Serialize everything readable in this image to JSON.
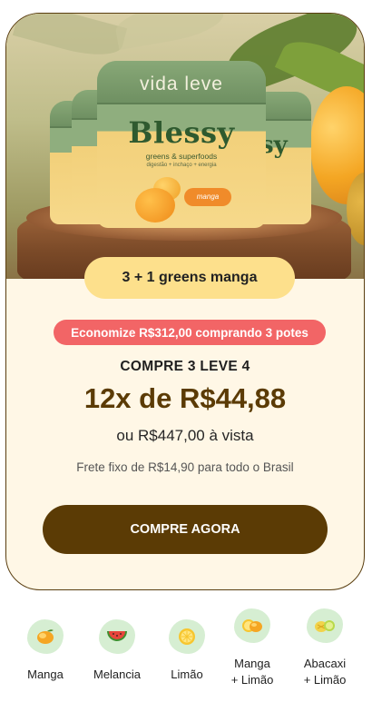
{
  "hero": {
    "jar_brand": "vida leve",
    "jar_product": "Blessy",
    "jar_subtitle": "greens & superfoods",
    "jar_tagline": "digestão + inchaço + energia",
    "jar_flavor_tag": "manga"
  },
  "bundle": {
    "pill_label": "3 + 1 greens manga",
    "savings_badge": "Economize R$312,00 comprando 3 potes",
    "offer_title": "COMPRE 3 LEVE 4",
    "installments": "12x de R$44,88",
    "cash_price": "ou R$447,00 à vista",
    "shipping": "Frete fixo de R$14,90 para todo o Brasil",
    "cta_label": "COMPRE AGORA"
  },
  "flavors": [
    {
      "label": "Manga",
      "icon": "mango-icon"
    },
    {
      "label": "Melancia",
      "icon": "watermelon-icon"
    },
    {
      "label": "Limão",
      "icon": "lemon-icon"
    },
    {
      "label_line1": "Manga",
      "label_line2": "+ Limão",
      "icon": "mango-lemon-icon"
    },
    {
      "label_line1": "Abacaxi",
      "label_line2": "+ Limão",
      "icon": "pineapple-lemon-icon"
    }
  ],
  "colors": {
    "card_bg": "#fff7e6",
    "card_border": "#5a3e10",
    "pill_bg": "#fde08c",
    "savings_bg": "#f26566",
    "price_color": "#5b3b05",
    "cta_bg": "#5b3b05",
    "flavor_blob": "#d6eed2"
  }
}
